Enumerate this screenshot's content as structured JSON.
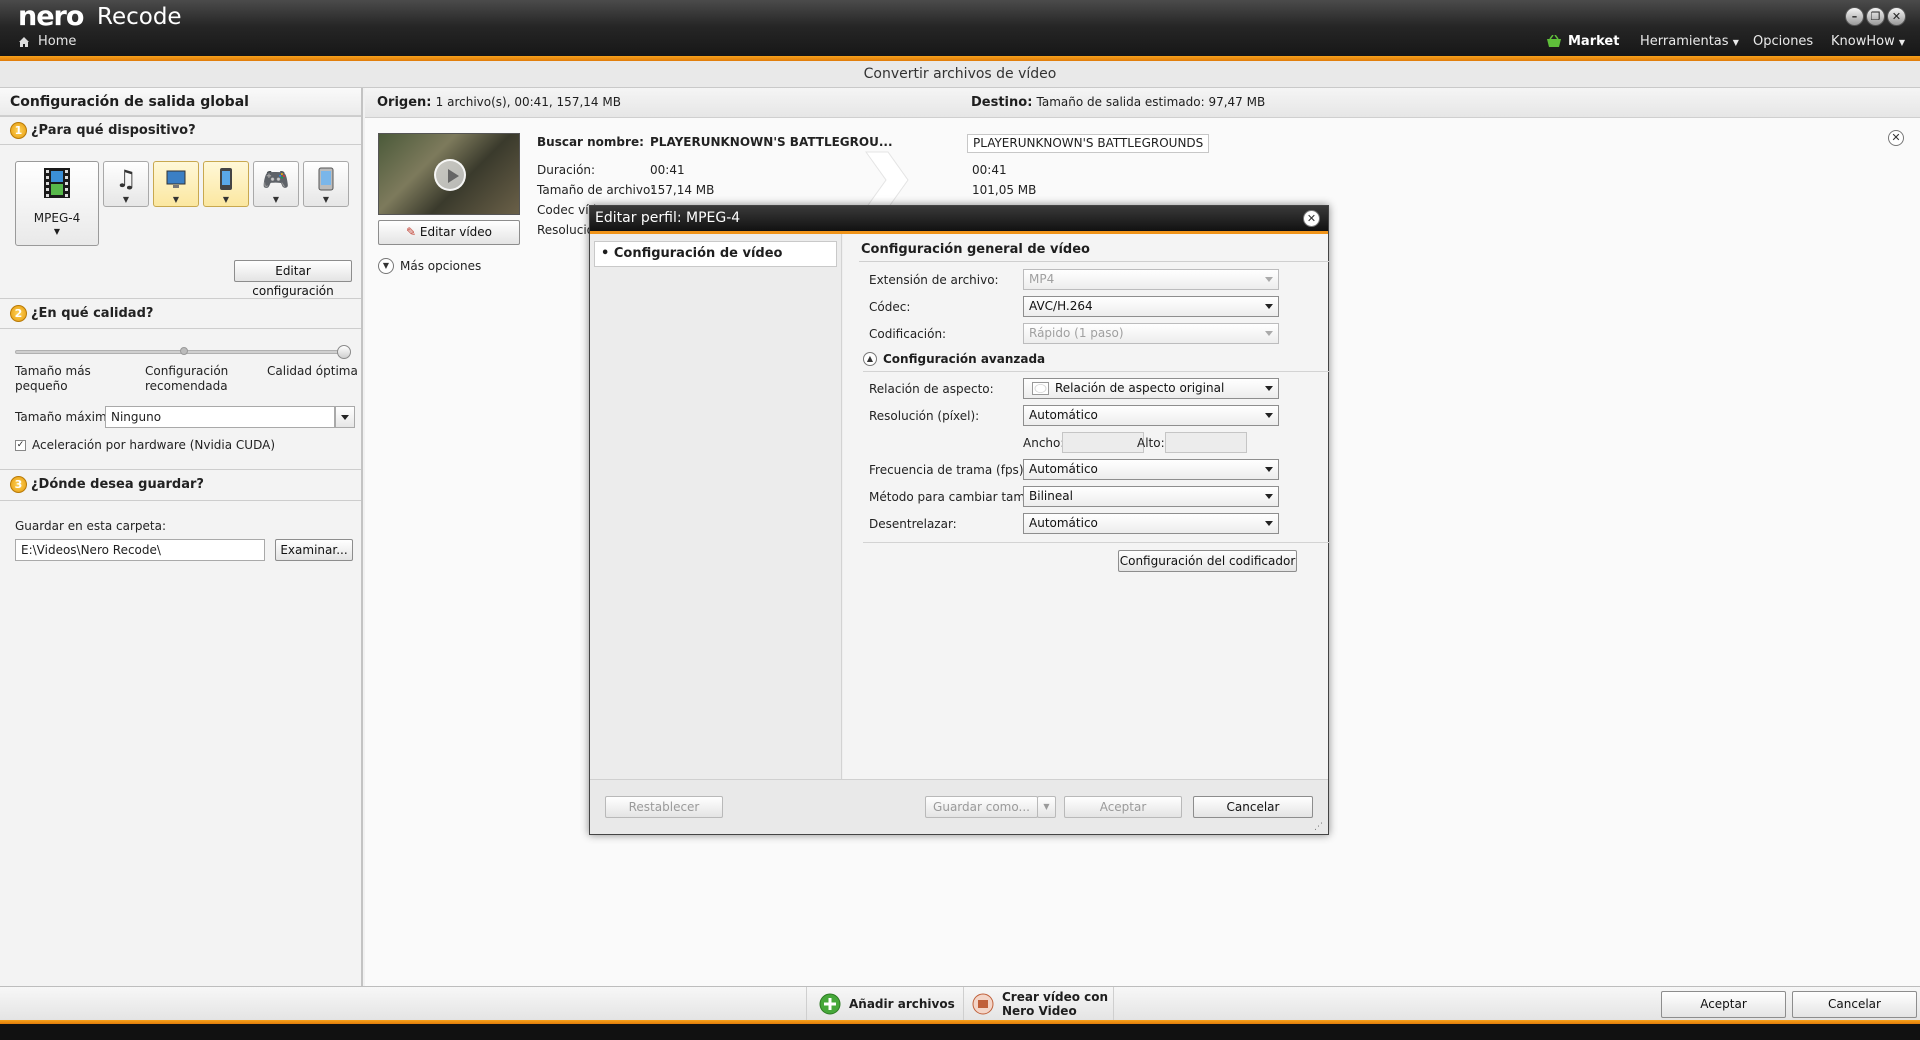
{
  "app": {
    "brand_nero": "nero",
    "brand_product": "Recode",
    "home_label": "Home",
    "menu": {
      "market": "Market",
      "tools": "Herramientas",
      "options": "Opciones",
      "knowhow": "KnowHow"
    },
    "window_title": "Convertir archivos de vídeo",
    "accent_color": "#f09419"
  },
  "left_panel": {
    "header": "Configuración de salida global",
    "device": {
      "step": "1",
      "title": "¿Para qué dispositivo?",
      "selected_label": "MPEG-4",
      "edit_button": "Editar configuración"
    },
    "quality": {
      "step": "2",
      "title": "¿En qué calidad?",
      "label_left": "Tamaño más pequeño",
      "label_mid": "Configuración recomendada",
      "label_right": "Calidad óptima",
      "slider_position": 1.0,
      "max_size_label": "Tamaño máximo:",
      "max_size_value": "Ninguno",
      "hw_accel_label": "Aceleración por hardware (Nvidia CUDA)",
      "hw_accel_checked": true
    },
    "save": {
      "step": "3",
      "title": "¿Dónde desea guardar?",
      "folder_label": "Guardar en esta carpeta:",
      "folder_value": "E:\\Videos\\Nero Recode\\",
      "browse_button": "Examinar..."
    }
  },
  "main": {
    "origin_label": "Origen:",
    "origin_value": "1 archivo(s), 00:41, 157,14 MB",
    "dest_label": "Destino:",
    "dest_value": "Tamaño de salida estimado: 97,47 MB",
    "source": {
      "name_label": "Buscar nombre:",
      "name_value": "PLAYERUNKNOWN'S BATTLEGROU...",
      "duration_label": "Duración:",
      "duration_value": "00:41",
      "size_label": "Tamaño de archivo:",
      "size_value": "157,14 MB",
      "codec_label": "Codec víd",
      "res_label": "Resolució"
    },
    "target": {
      "name_value": "PLAYERUNKNOWN'S BATTLEGROUNDS",
      "duration_value": "00:41",
      "size_value": "101,05 MB"
    },
    "edit_video_button": "Editar vídeo",
    "more_options": "Más opciones"
  },
  "dialog": {
    "title": "Editar perfil: MPEG-4",
    "nav_item": "Configuración de vídeo",
    "section_title": "Configuración general de vídeo",
    "file_ext_label": "Extensión de archivo:",
    "file_ext_value": "MP4",
    "codec_label": "Códec:",
    "codec_value": "AVC/H.264",
    "encoding_label": "Codificación:",
    "encoding_value": "Rápido (1 paso)",
    "advanced_title": "Configuración avanzada",
    "aspect_label": "Relación de aspecto:",
    "aspect_value": "Relación de aspecto original",
    "resolution_label": "Resolución (píxel):",
    "resolution_value": "Automático",
    "width_label": "Ancho:",
    "height_label": "Alto:",
    "fps_label": "Frecuencia de trama (fps):",
    "fps_value": "Automático",
    "resize_label": "Método para cambiar tamaño:",
    "resize_value": "Bilineal",
    "deinterlace_label": "Desentrelazar:",
    "deinterlace_value": "Automático",
    "encoder_button": "Configuración del codificador",
    "reset_button": "Restablecer",
    "save_as_button": "Guardar como...",
    "accept_button": "Aceptar",
    "cancel_button": "Cancelar"
  },
  "bottom": {
    "add_files": "Añadir archivos",
    "create_video_line1": "Crear vídeo con",
    "create_video_line2": "Nero Video",
    "accept": "Aceptar",
    "cancel": "Cancelar"
  }
}
